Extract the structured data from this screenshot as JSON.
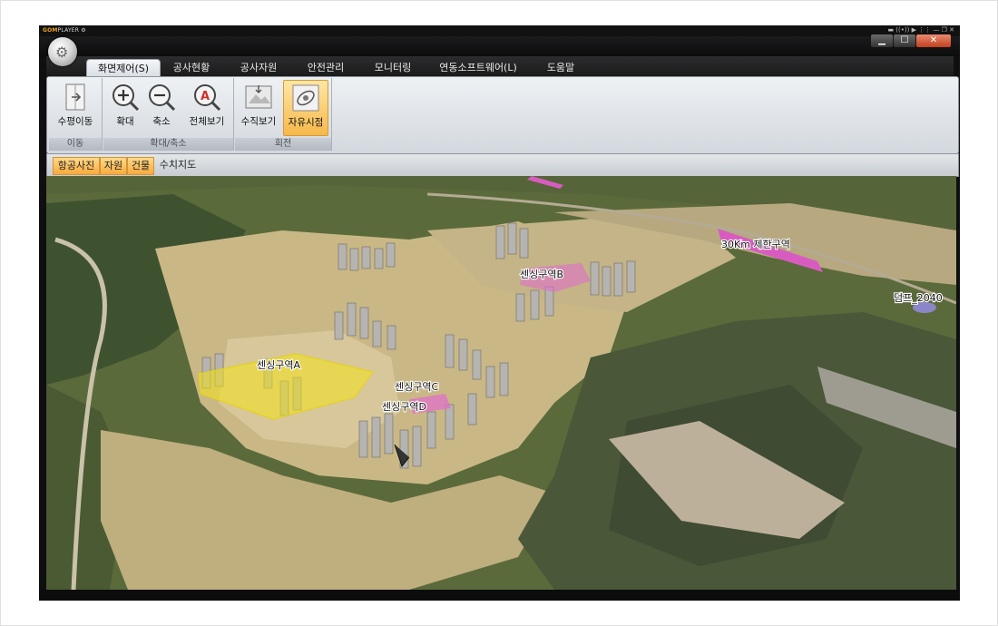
{
  "player": {
    "brand_prefix": "GOM",
    "brand_suffix": "PLAYER",
    "controls": "▬ ((•)) ▶ ⋮⋮ — ❐ ✕"
  },
  "window_buttons": {
    "minimize": "▁",
    "maximize": "☐",
    "close": "✕"
  },
  "tabs": [
    {
      "label": "화면제어(S)",
      "active": true
    },
    {
      "label": "공사현황"
    },
    {
      "label": "공사자원"
    },
    {
      "label": "안전관리"
    },
    {
      "label": "모니터링"
    },
    {
      "label": "연동소프트웨어(L)"
    },
    {
      "label": "도움말"
    }
  ],
  "ribbon": {
    "groups": [
      {
        "label": "이동",
        "buttons": [
          {
            "label": "수평이동",
            "icon": "pan-icon"
          }
        ]
      },
      {
        "label": "확대/축소",
        "buttons": [
          {
            "label": "확대",
            "icon": "zoom-in-icon"
          },
          {
            "label": "축소",
            "icon": "zoom-out-icon"
          },
          {
            "label": "전체보기",
            "icon": "full-view-icon"
          }
        ]
      },
      {
        "label": "회전",
        "buttons": [
          {
            "label": "수직보기",
            "icon": "vertical-view-icon"
          },
          {
            "label": "자유시점",
            "icon": "free-view-icon",
            "active": true
          }
        ]
      }
    ]
  },
  "layers": [
    {
      "label": "항공사진",
      "on": true
    },
    {
      "label": "자원",
      "on": true
    },
    {
      "label": "건물",
      "on": true
    },
    {
      "label": "수치지도",
      "on": false
    }
  ],
  "map": {
    "labels": {
      "zone_a": "센싱구역A",
      "zone_b": "센싱구역B",
      "zone_c": "센싱구역C",
      "zone_d": "센싱구역D",
      "restricted": "30Km 제한구역",
      "dump": "덤프_2040"
    },
    "colors": {
      "zone_a": "#f2e21a",
      "zone_pink": "#e070c8",
      "restricted": "#d85cc0",
      "dump": "#8a86c8"
    }
  }
}
